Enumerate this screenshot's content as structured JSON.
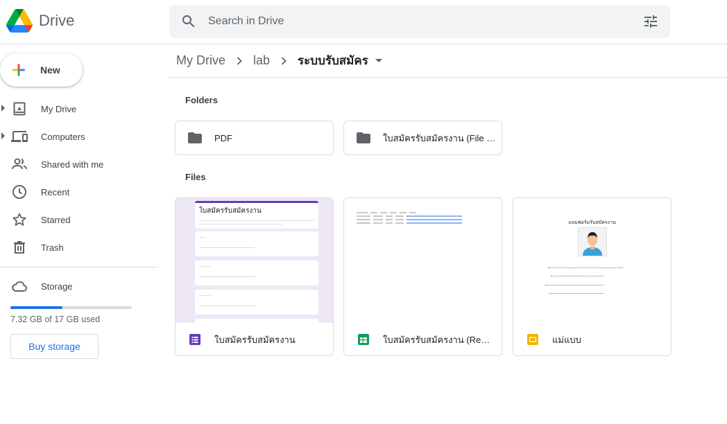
{
  "app": {
    "name": "Drive"
  },
  "search": {
    "placeholder": "Search in Drive"
  },
  "sidebar": {
    "new_label": "New",
    "items": [
      {
        "label": "My Drive",
        "icon": "my-drive-icon",
        "expandable": true
      },
      {
        "label": "Computers",
        "icon": "computers-icon",
        "expandable": true
      },
      {
        "label": "Shared with me",
        "icon": "shared-icon",
        "expandable": false
      },
      {
        "label": "Recent",
        "icon": "clock-icon",
        "expandable": false
      },
      {
        "label": "Starred",
        "icon": "star-icon",
        "expandable": false
      },
      {
        "label": "Trash",
        "icon": "trash-icon",
        "expandable": false
      }
    ],
    "storage": {
      "label": "Storage",
      "used_text": "7.32 GB of 17 GB used",
      "used_fraction": 0.43,
      "buy_label": "Buy storage"
    }
  },
  "breadcrumb": {
    "items": [
      "My Drive",
      "lab"
    ],
    "current": "ระบบรับสมัคร"
  },
  "sections": {
    "folders_title": "Folders",
    "files_title": "Files"
  },
  "folders": [
    {
      "name": "PDF"
    },
    {
      "name": "ใบสมัครรับสมัครงาน (File responses)"
    }
  ],
  "files": [
    {
      "name": "ใบสมัครรับสมัครงาน",
      "type": "form",
      "icon": "google-forms-icon",
      "thumb_title": "ใบสมัครรับสมัครงาน"
    },
    {
      "name": "ใบสมัครรับสมัครงาน (Responses)",
      "type": "sheet",
      "icon": "google-sheets-icon"
    },
    {
      "name": "แม่แบบ",
      "type": "slide",
      "icon": "google-slides-icon",
      "thumb_title": "แบบฟอร์มรับสมัครงาน"
    }
  ],
  "colors": {
    "accent": "#1a73e8",
    "forms": "#673ab7",
    "sheets": "#0f9d58",
    "slides": "#f4b400",
    "folder": "#5f6368"
  }
}
